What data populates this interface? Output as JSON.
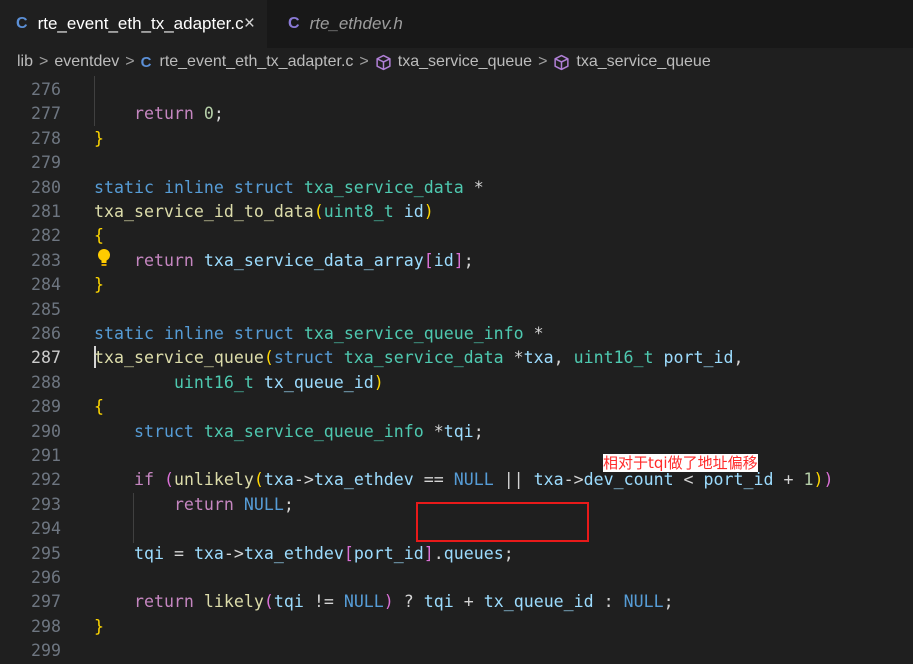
{
  "tabs": [
    {
      "icon": "C",
      "label": "rte_event_eth_tx_adapter.c",
      "close": "×"
    },
    {
      "icon": "C",
      "label": "rte_ethdev.h"
    }
  ],
  "breadcrumb": {
    "lib": "lib",
    "eventdev": "eventdev",
    "file_icon": "C",
    "file": "rte_event_eth_tx_adapter.c",
    "symbol1": "txa_service_queue",
    "symbol2": "txa_service_queue",
    "separator": ">"
  },
  "editor": {
    "lines": [
      {
        "no": "276",
        "tokens": []
      },
      {
        "no": "277",
        "tokens": [
          [
            "p",
            "    "
          ],
          [
            "kc",
            "return"
          ],
          [
            "p",
            " "
          ],
          [
            "nu",
            "0"
          ],
          [
            "p",
            ";"
          ]
        ]
      },
      {
        "no": "278",
        "tokens": [
          [
            "br1",
            "}"
          ]
        ]
      },
      {
        "no": "279",
        "tokens": []
      },
      {
        "no": "280",
        "tokens": [
          [
            "kw",
            "static"
          ],
          [
            "p",
            " "
          ],
          [
            "kw",
            "inline"
          ],
          [
            "p",
            " "
          ],
          [
            "kw",
            "struct"
          ],
          [
            "p",
            " "
          ],
          [
            "ty",
            "txa_service_data"
          ],
          [
            "p",
            " *"
          ]
        ]
      },
      {
        "no": "281",
        "tokens": [
          [
            "fn",
            "txa_service_id_to_data"
          ],
          [
            "br1",
            "("
          ],
          [
            "ty",
            "uint8_t"
          ],
          [
            "p",
            " "
          ],
          [
            "va",
            "id"
          ],
          [
            "br1",
            ")"
          ]
        ]
      },
      {
        "no": "282",
        "tokens": [
          [
            "br1",
            "{"
          ]
        ]
      },
      {
        "no": "283",
        "tokens": [
          [
            "p",
            "    "
          ],
          [
            "kc",
            "return"
          ],
          [
            "p",
            " "
          ],
          [
            "va",
            "txa_service_data_array"
          ],
          [
            "br2",
            "["
          ],
          [
            "va",
            "id"
          ],
          [
            "br2",
            "]"
          ],
          [
            "p",
            ";"
          ]
        ]
      },
      {
        "no": "284",
        "tokens": [
          [
            "br1",
            "}"
          ]
        ]
      },
      {
        "no": "285",
        "tokens": []
      },
      {
        "no": "286",
        "tokens": [
          [
            "kw",
            "static"
          ],
          [
            "p",
            " "
          ],
          [
            "kw",
            "inline"
          ],
          [
            "p",
            " "
          ],
          [
            "kw",
            "struct"
          ],
          [
            "p",
            " "
          ],
          [
            "ty",
            "txa_service_queue_info"
          ],
          [
            "p",
            " *"
          ]
        ]
      },
      {
        "no": "287",
        "tokens": [
          [
            "fn",
            "txa_service_queue"
          ],
          [
            "br1",
            "("
          ],
          [
            "kw",
            "struct"
          ],
          [
            "p",
            " "
          ],
          [
            "ty",
            "txa_service_data"
          ],
          [
            "p",
            " *"
          ],
          [
            "va",
            "txa"
          ],
          [
            "p",
            ", "
          ],
          [
            "ty",
            "uint16_t"
          ],
          [
            "p",
            " "
          ],
          [
            "va",
            "port_id"
          ],
          [
            "p",
            ","
          ]
        ]
      },
      {
        "no": "288",
        "tokens": [
          [
            "p",
            "        "
          ],
          [
            "ty",
            "uint16_t"
          ],
          [
            "p",
            " "
          ],
          [
            "va",
            "tx_queue_id"
          ],
          [
            "br1",
            ")"
          ]
        ]
      },
      {
        "no": "289",
        "tokens": [
          [
            "br1",
            "{"
          ]
        ]
      },
      {
        "no": "290",
        "tokens": [
          [
            "p",
            "    "
          ],
          [
            "kw",
            "struct"
          ],
          [
            "p",
            " "
          ],
          [
            "ty",
            "txa_service_queue_info"
          ],
          [
            "p",
            " *"
          ],
          [
            "va",
            "tqi"
          ],
          [
            "p",
            ";"
          ]
        ]
      },
      {
        "no": "291",
        "tokens": []
      },
      {
        "no": "292",
        "tokens": [
          [
            "p",
            "    "
          ],
          [
            "kc",
            "if"
          ],
          [
            "p",
            " "
          ],
          [
            "br2",
            "("
          ],
          [
            "fn",
            "unlikely"
          ],
          [
            "br1",
            "("
          ],
          [
            "va",
            "txa"
          ],
          [
            "p",
            "->"
          ],
          [
            "va",
            "txa_ethdev"
          ],
          [
            "p",
            " == "
          ],
          [
            "kw",
            "NULL"
          ],
          [
            "p",
            " || "
          ],
          [
            "va",
            "txa"
          ],
          [
            "p",
            "->"
          ],
          [
            "va",
            "dev_count"
          ],
          [
            "p",
            " < "
          ],
          [
            "va",
            "port_id"
          ],
          [
            "p",
            " + "
          ],
          [
            "nu",
            "1"
          ],
          [
            "br1",
            ")"
          ],
          [
            "br2",
            ")"
          ]
        ]
      },
      {
        "no": "293",
        "tokens": [
          [
            "p",
            "        "
          ],
          [
            "kc",
            "return"
          ],
          [
            "p",
            " "
          ],
          [
            "kw",
            "NULL"
          ],
          [
            "p",
            ";"
          ]
        ]
      },
      {
        "no": "294",
        "tokens": []
      },
      {
        "no": "295",
        "tokens": [
          [
            "p",
            "    "
          ],
          [
            "va",
            "tqi"
          ],
          [
            "p",
            " = "
          ],
          [
            "va",
            "txa"
          ],
          [
            "p",
            "->"
          ],
          [
            "va",
            "txa_ethdev"
          ],
          [
            "br2",
            "["
          ],
          [
            "va",
            "port_id"
          ],
          [
            "br2",
            "]"
          ],
          [
            "p",
            "."
          ],
          [
            "va",
            "queues"
          ],
          [
            "p",
            ";"
          ]
        ]
      },
      {
        "no": "296",
        "tokens": []
      },
      {
        "no": "297",
        "tokens": [
          [
            "p",
            "    "
          ],
          [
            "kc",
            "return"
          ],
          [
            "p",
            " "
          ],
          [
            "fn",
            "likely"
          ],
          [
            "br2",
            "("
          ],
          [
            "va",
            "tqi"
          ],
          [
            "p",
            " != "
          ],
          [
            "kw",
            "NULL"
          ],
          [
            "br2",
            ")"
          ],
          [
            "p",
            " ? "
          ],
          [
            "va",
            "tqi"
          ],
          [
            "p",
            " + "
          ],
          [
            "va",
            "tx_queue_id"
          ],
          [
            "p",
            " : "
          ],
          [
            "kw",
            "NULL"
          ],
          [
            "p",
            ";"
          ]
        ]
      },
      {
        "no": "298",
        "tokens": [
          [
            "br1",
            "}"
          ]
        ]
      },
      {
        "no": "299",
        "tokens": []
      }
    ]
  },
  "annotation": {
    "text": "相对于tqi做了地址偏移"
  },
  "colors": {
    "accent_red": "#e81a1a",
    "bulb": "#ffcc00"
  }
}
